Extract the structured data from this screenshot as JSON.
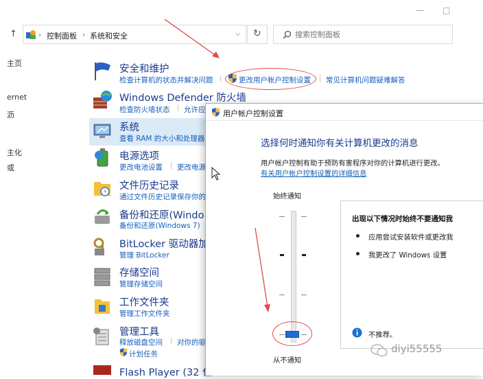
{
  "window": {
    "minimize_glyph": "—",
    "maximize_glyph": "□"
  },
  "address_bar": {
    "crumb_root": "控制面板",
    "crumb_current": "系统和安全",
    "separator": "›"
  },
  "search": {
    "placeholder": "搜索控制面板"
  },
  "left_nav": [
    "主页",
    "",
    "ernet",
    "",
    "",
    "主化",
    "或"
  ],
  "categories": [
    {
      "title": "安全和维护",
      "links": [
        "检查计算机的状态并解决问题",
        "更改用户帐户控制设置",
        "常见计算机问题疑难解答"
      ]
    },
    {
      "title": "Windows Defender 防火墙",
      "links": [
        "检查防火墙状态",
        "允许应"
      ]
    },
    {
      "title": "系统",
      "links": [
        "查看 RAM 的大小和处理器"
      ]
    },
    {
      "title": "电源选项",
      "links": [
        "更改电池设置",
        "更改电源"
      ]
    },
    {
      "title": "文件历史记录",
      "links": [
        "通过文件历史记录保存你的"
      ]
    },
    {
      "title": "备份和还原(Windo",
      "links": [
        "备份和还原(Windows 7)"
      ]
    },
    {
      "title": "BitLocker 驱动器加",
      "links": [
        "管理 BitLocker"
      ]
    },
    {
      "title": "存储空间",
      "links": [
        "管理存储空间"
      ]
    },
    {
      "title": "工作文件夹",
      "links": [
        "管理工作文件夹"
      ]
    },
    {
      "title": "管理工具",
      "links": [
        "释放磁盘空间",
        "对你的驱",
        "计划任务"
      ]
    },
    {
      "title": "Flash Player (32 位",
      "links": []
    }
  ],
  "dialog": {
    "title": "用户帐户控制设置",
    "heading": "选择何时通知你有关计算机更改的消息",
    "description": "用户帐户控制有助于预防有害程序对你的计算机进行更改。",
    "more_link": "有关用户帐户控制设置的详细信息",
    "slider_top_label": "始终通知",
    "slider_bottom_label": "从不通知",
    "slider_level": 0,
    "panel_title": "出现以下情况时始终不要通知我",
    "panel_items": [
      "应用尝试安装软件或更改我",
      "我更改了 Windows 设置"
    ],
    "recommend_text": "不推荐。"
  },
  "watermark": {
    "text": "diyi55555"
  },
  "colors": {
    "link": "#1560bd",
    "title": "#1b3a8c",
    "slider_thumb": "#1a6fd0",
    "annotation": "#e04a4a",
    "selection": "#dbeaf7"
  }
}
